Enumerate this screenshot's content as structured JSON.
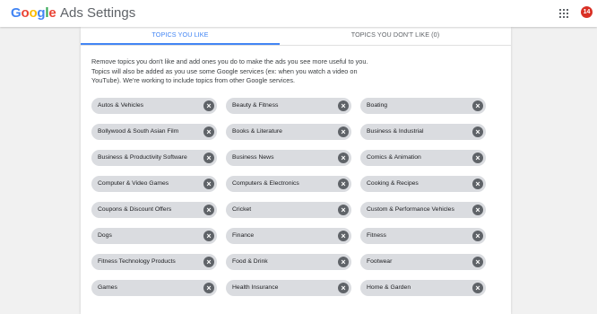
{
  "header": {
    "logo_letters": [
      {
        "ch": "G",
        "color": "#4285f4"
      },
      {
        "ch": "o",
        "color": "#ea4335"
      },
      {
        "ch": "o",
        "color": "#fbbc05"
      },
      {
        "ch": "g",
        "color": "#4285f4"
      },
      {
        "ch": "l",
        "color": "#34a853"
      },
      {
        "ch": "e",
        "color": "#ea4335"
      }
    ],
    "app_name": "Ads Settings",
    "apps_icon": "apps-grid-icon",
    "avatar_badge": "14"
  },
  "tabs": [
    {
      "label": "TOPICS YOU LIKE",
      "active": true
    },
    {
      "label": "TOPICS YOU DON'T LIKE (0)",
      "active": false
    }
  ],
  "description": "Remove topics you don't like and add ones you do to make the ads you see more useful to you. Topics will also be added as you use some Google services (ex: when you watch a video on YouTube). We're working to include topics from other Google services.",
  "topics": [
    "Autos & Vehicles",
    "Beauty & Fitness",
    "Boating",
    "Bollywood & South Asian Film",
    "Books & Literature",
    "Business & Industrial",
    "Business & Productivity Software",
    "Business News",
    "Comics & Animation",
    "Computer & Video Games",
    "Computers & Electronics",
    "Cooking & Recipes",
    "Coupons & Discount Offers",
    "Cricket",
    "Custom & Performance Vehicles",
    "Dogs",
    "Finance",
    "Fitness",
    "Fitness Technology Products",
    "Food & Drink",
    "Footwear",
    "Games",
    "Health Insurance",
    "Home & Garden"
  ],
  "remove_icon": "close-circle-icon",
  "colors": {
    "accent": "#4285f4",
    "chip_bg": "#dadce0",
    "remove_bg": "#5f6368",
    "avatar_bg": "#d93025"
  }
}
